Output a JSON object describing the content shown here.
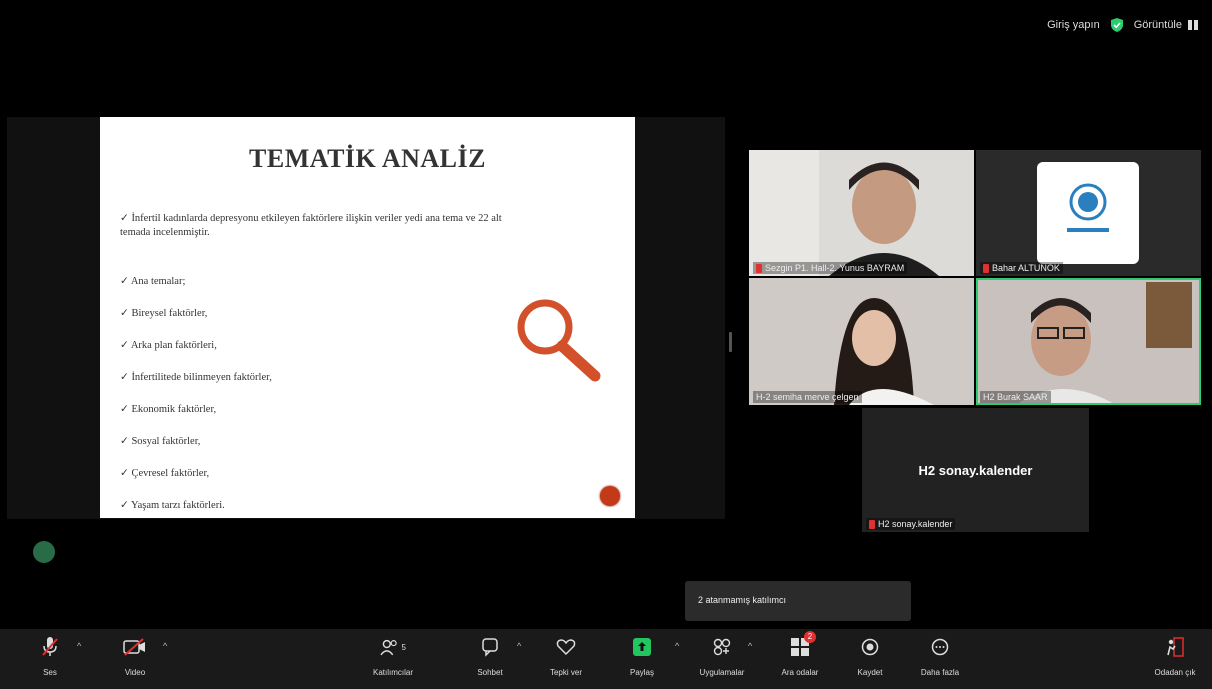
{
  "top": {
    "signin_label": "Giriş yapın",
    "view_label": "Görüntüle"
  },
  "slide": {
    "title": "TEMATİK ANALİZ",
    "bullets": [
      "İnfertil kadınlarda depresyonu etkileyen faktörlere ilişkin veriler yedi ana tema ve 22 alt temada incelenmiştir.",
      "Ana temalar;",
      "Bireysel faktörler,",
      "Arka plan faktörleri,",
      "İnfertilitede bilinmeyen faktörler,",
      "Ekonomik faktörler,",
      "Sosyal faktörler,",
      "Çevresel faktörler,",
      "Yaşam tarzı faktörleri."
    ]
  },
  "participants": [
    {
      "name": "Sezgin P1. Hall-2. Yunus BAYRAM"
    },
    {
      "name": "Bahar ALTUNOK"
    },
    {
      "name": "H-2 semiha merve çelgen"
    },
    {
      "name": "H2 Burak SAAR"
    },
    {
      "name": "H2 sonay.kalender",
      "display": "H2 sonay.kalender"
    }
  ],
  "tooltip": "2 atanmamış katılımcı",
  "toolbar": {
    "audio": "Ses",
    "video": "Video",
    "participants": "Katılımcılar",
    "participants_count": "5",
    "chat": "Sohbet",
    "reactions": "Tepki ver",
    "share": "Paylaş",
    "apps": "Uygulamalar",
    "breakout": "Ara odalar",
    "breakout_badge": "2",
    "record": "Kaydet",
    "more": "Daha fazla",
    "leave": "Odadan çık"
  },
  "colors": {
    "accent_green": "#2ecc71",
    "mute_red": "#e03030",
    "slide_red": "#d2502a"
  }
}
